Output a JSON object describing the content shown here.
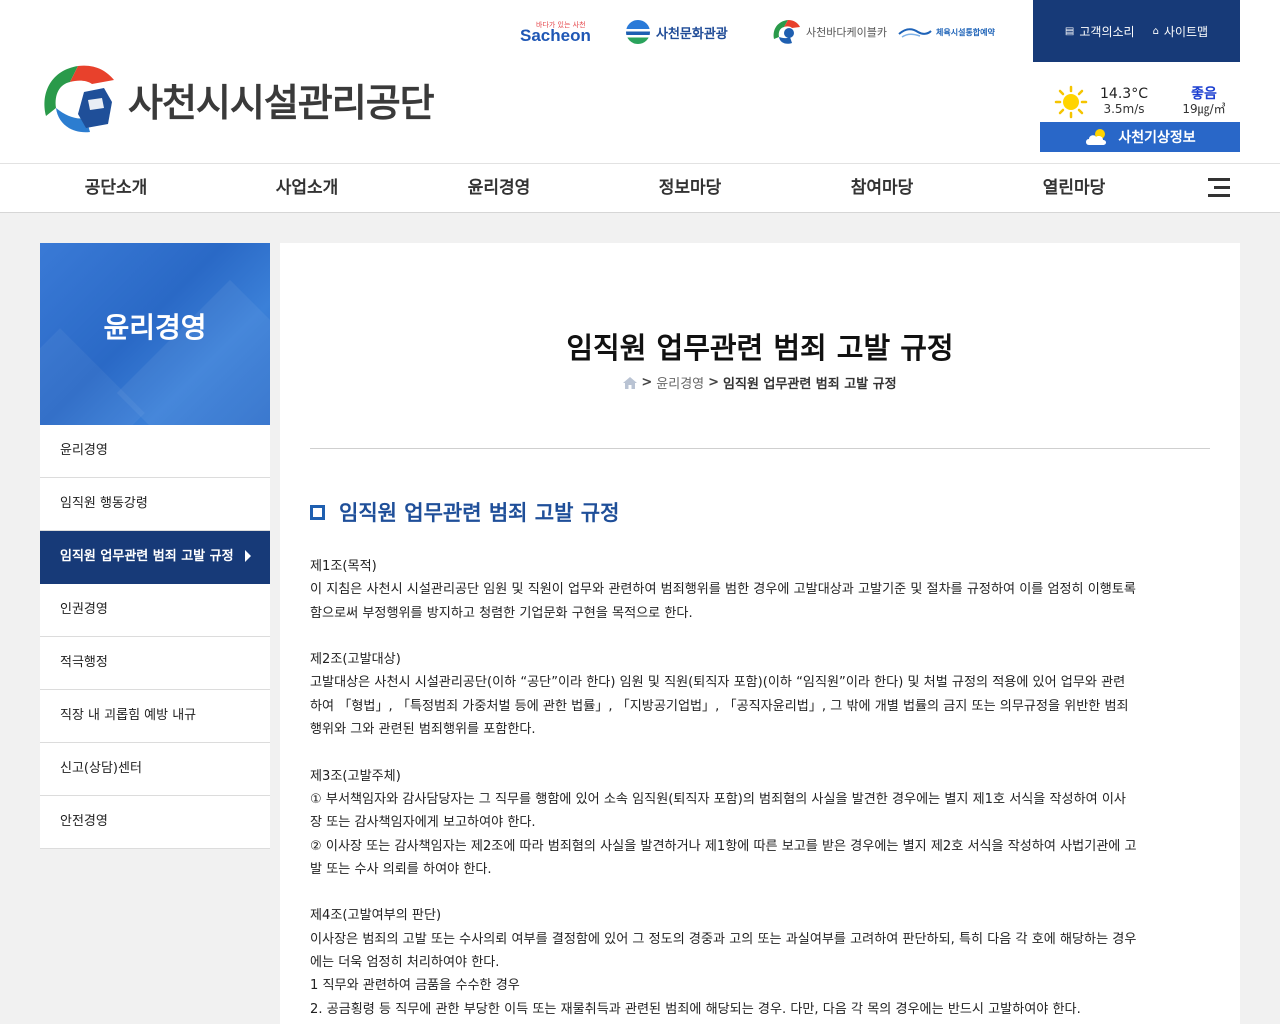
{
  "family_sites": {
    "sacheon_small": "바다가 있는 사천",
    "sacheon": "Sacheon",
    "culture": "사천문화관광",
    "cable_car": "사천바다케이블카",
    "sports": "체육시설통합예약"
  },
  "utility": {
    "voice": "고객의소리",
    "sitemap": "사이트맵"
  },
  "logo": {
    "name": "사천시시설관리공단"
  },
  "weather": {
    "temperature": "14.3°C",
    "wind": "3.5m/s",
    "air_grade": "좋음",
    "air_value": "19㎍/㎥",
    "button": "사천기상정보",
    "colors": {
      "accent": "#2967c8",
      "grade": "#1c3fd1"
    }
  },
  "gnb": [
    "공단소개",
    "사업소개",
    "윤리경영",
    "정보마당",
    "참여마당",
    "열린마당"
  ],
  "sidebar": {
    "title": "윤리경영",
    "items": [
      "윤리경영",
      "임직원 행동강령",
      "임직원 업무관련 범죄 고발 규정",
      "인권경영",
      "적극행정",
      "직장 내 괴롭힘 예방 내규",
      "신고(상담)센터",
      "안전경영"
    ],
    "active_index": 2
  },
  "page": {
    "title": "임직원 업무관련 범죄 고발 규정",
    "breadcrumb": {
      "sep": ">",
      "parent": "윤리경영",
      "current": "임직원 업무관련 범죄 고발 규정"
    },
    "section_title": "임직원 업무관련 범죄 고발 규정"
  },
  "articles": {
    "a1_title": "제1조(목적)",
    "a1_l1": "이 지침은 사천시 시설관리공단 임원 및 직원이 업무와 관련하여 범죄행위를 범한 경우에 고발대상과 고발기준 및 절차를 규정하여 이를 엄정히 이행토록",
    "a1_l2": "함으로써 부정행위를 방지하고 청렴한 기업문화 구현을 목적으로 한다.",
    "a2_title": "제2조(고발대상)",
    "a2_l1": "고발대상은 사천시 시설관리공단(이하 “공단”이라 한다) 임원 및 직원(퇴직자 포함)(이하 “임직원”이라 한다) 및 처벌 규정의 적용에 있어 업무와 관련",
    "a2_l2": "하여 「형법」, 「특정범죄 가중처벌 등에 관한 법률」, 「지방공기업법」, 「공직자윤리법」, 그 밖에 개별 법률의 금지 또는 의무규정을 위반한 범죄",
    "a2_l3": "행위와 그와 관련된 범죄행위를 포함한다.",
    "a3_title": "제3조(고발주체)",
    "a3_l1": "① 부서책임자와 감사담당자는 그 직무를 행함에 있어 소속 임직원(퇴직자 포함)의 범죄혐의 사실을 발견한 경우에는 별지 제1호 서식을 작성하여 이사",
    "a3_l2": "장 또는 감사책임자에게 보고하여야 한다.",
    "a3_l3": "② 이사장 또는 감사책임자는 제2조에 따라 범죄혐의 사실을 발견하거나 제1항에 따른 보고를 받은 경우에는 별지 제2호 서식을 작성하여 사법기관에 고",
    "a3_l4": "발 또는 수사 의뢰를 하여야 한다.",
    "a4_title": "제4조(고발여부의 판단)",
    "a4_l1": "이사장은 범죄의 고발 또는 수사의뢰 여부를 결정함에 있어 그 정도의 경중과 고의 또는 과실여부를 고려하여 판단하되, 특히 다음 각 호에 해당하는 경우",
    "a4_l2": "에는 더욱 엄정히 처리하여야 한다.",
    "a4_l3": "1 직무와 관련하여 금품을 수수한 경우",
    "a4_l4": "2. 공금횡령 등 직무에 관한 부당한 이득 또는 재물취득과 관련된 범죄에 해당되는 경우. 다만, 다음 각 목의 경우에는 반드시 고발하여야 한다."
  }
}
